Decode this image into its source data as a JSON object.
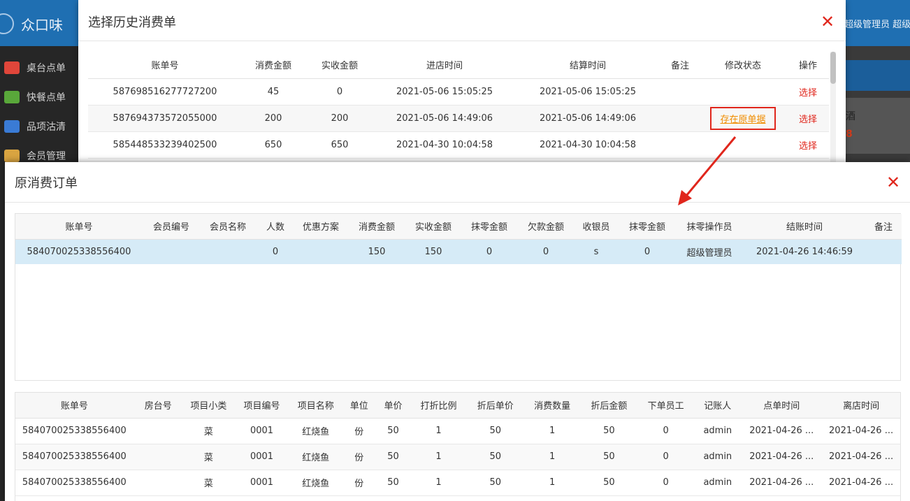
{
  "app": {
    "title": "众口味",
    "user_text": "超级管理员 超级管理员",
    "sidebar": [
      {
        "label": "桌台点单",
        "icon": "table-icon",
        "color": "#e0463a"
      },
      {
        "label": "快餐点单",
        "icon": "fork-knife-icon",
        "color": "#59a83a"
      },
      {
        "label": "品项沽清",
        "icon": "box-icon",
        "color": "#3a7bd5"
      },
      {
        "label": "会员管理",
        "icon": "members-icon",
        "color": "#d9a441"
      }
    ],
    "right_item_name": "酒",
    "right_item_price": "8"
  },
  "dialog1": {
    "title": "选择历史消费单",
    "columns": [
      "账单号",
      "消费金额",
      "实收金额",
      "进店时间",
      "结算时间",
      "备注",
      "修改状态",
      "操作"
    ],
    "rows": [
      {
        "bill_no": "587698516277727200",
        "amount": "45",
        "received": "0",
        "enter_time": "2021-05-06 15:05:25",
        "settle_time": "2021-05-06 15:05:25",
        "remark": "",
        "status": "",
        "action": "选择"
      },
      {
        "bill_no": "587694373572055000",
        "amount": "200",
        "received": "200",
        "enter_time": "2021-05-06 14:49:06",
        "settle_time": "2021-05-06 14:49:06",
        "remark": "",
        "status": "存在原单据",
        "action": "选择"
      },
      {
        "bill_no": "585448533239402500",
        "amount": "650",
        "received": "650",
        "enter_time": "2021-04-30 10:04:58",
        "settle_time": "2021-04-30 10:04:58",
        "remark": "",
        "status": "",
        "action": "选择"
      }
    ]
  },
  "dialog2": {
    "title": "原消费订单",
    "order_columns": [
      "账单号",
      "会员编号",
      "会员名称",
      "人数",
      "优惠方案",
      "消费金额",
      "实收金额",
      "抹零金额",
      "欠款金额",
      "收银员",
      "抹零金额",
      "抹零操作员",
      "结账时间",
      "备注"
    ],
    "order_row": [
      "584070025338556400",
      "",
      "",
      "0",
      "",
      "150",
      "150",
      "0",
      "0",
      "s",
      "0",
      "超级管理员",
      "2021-04-26 14:46:59",
      ""
    ],
    "item_columns": [
      "账单号",
      "房台号",
      "项目小类",
      "项目编号",
      "项目名称",
      "单位",
      "单价",
      "打折比例",
      "折后单价",
      "消费数量",
      "折后金额",
      "下单员工",
      "记账人",
      "点单时间",
      "离店时间"
    ],
    "item_rows": [
      [
        "584070025338556400",
        "",
        "菜",
        "0001",
        "红烧鱼",
        "份",
        "50",
        "1",
        "50",
        "1",
        "50",
        "0",
        "admin",
        "2021-04-26 ...",
        "2021-04-26 ..."
      ],
      [
        "584070025338556400",
        "",
        "菜",
        "0001",
        "红烧鱼",
        "份",
        "50",
        "1",
        "50",
        "1",
        "50",
        "0",
        "admin",
        "2021-04-26 ...",
        "2021-04-26 ..."
      ],
      [
        "584070025338556400",
        "",
        "菜",
        "0001",
        "红烧鱼",
        "份",
        "50",
        "1",
        "50",
        "1",
        "50",
        "0",
        "admin",
        "2021-04-26 ...",
        "2021-04-26 ..."
      ]
    ]
  }
}
